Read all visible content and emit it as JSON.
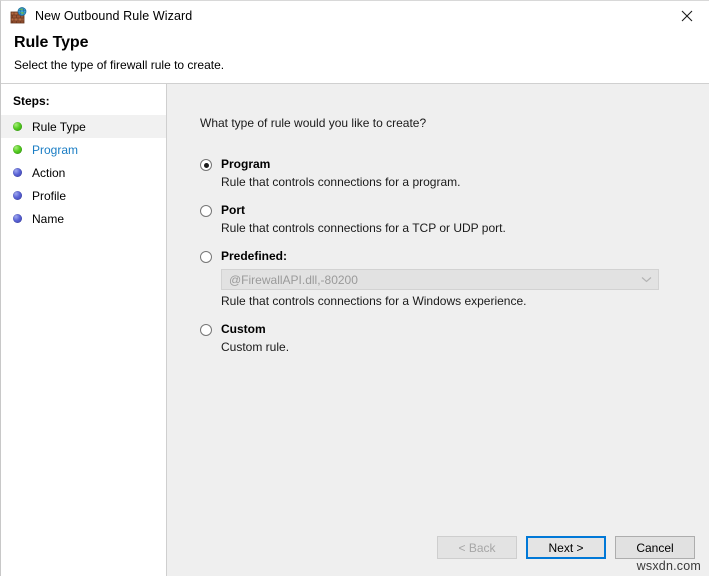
{
  "window": {
    "title": "New Outbound Rule Wizard",
    "icon": "firewall-globe-icon",
    "close_label": "✕"
  },
  "header": {
    "title": "Rule Type",
    "subtitle": "Select the type of firewall rule to create."
  },
  "sidebar": {
    "label": "Steps:",
    "items": [
      {
        "label": "Rule Type",
        "state": "current",
        "bullet": "green"
      },
      {
        "label": "Program",
        "state": "link",
        "bullet": "green"
      },
      {
        "label": "Action",
        "state": "pending",
        "bullet": "blue"
      },
      {
        "label": "Profile",
        "state": "pending",
        "bullet": "blue"
      },
      {
        "label": "Name",
        "state": "pending",
        "bullet": "blue"
      }
    ]
  },
  "main": {
    "question": "What type of rule would you like to create?",
    "options": [
      {
        "title": "Program",
        "description": "Rule that controls connections for a program.",
        "selected": true
      },
      {
        "title": "Port",
        "description": "Rule that controls connections for a TCP or UDP port.",
        "selected": false
      },
      {
        "title": "Predefined:",
        "description": "Rule that controls connections for a Windows experience.",
        "selected": false,
        "combo_value": "@FirewallAPI.dll,-80200",
        "combo_disabled": true
      },
      {
        "title": "Custom",
        "description": "Custom rule.",
        "selected": false
      }
    ]
  },
  "footer": {
    "back_label": "< Back",
    "next_label": "Next >",
    "cancel_label": "Cancel"
  },
  "watermark": "wsxdn.com",
  "colors": {
    "accent_focus": "#0078d7",
    "link": "#1a7dc4",
    "pane_background": "#efefef",
    "sidebar_background": "#ffffff",
    "bullet_done": "#55cc22",
    "bullet_pending": "#5a63d6"
  }
}
